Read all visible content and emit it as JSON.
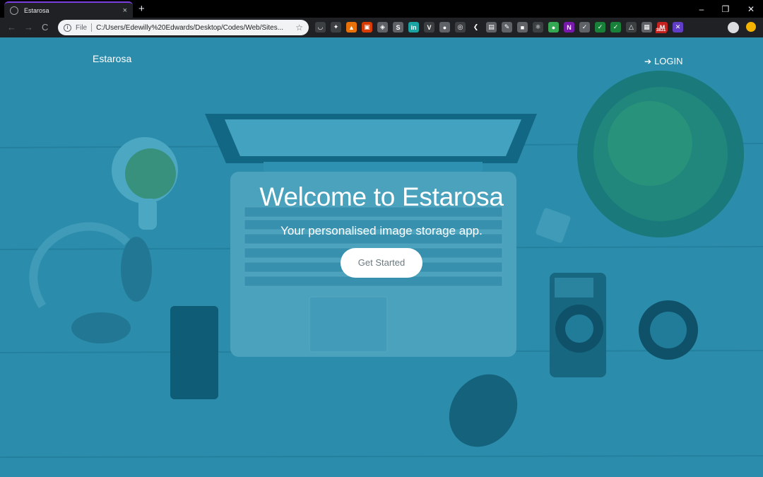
{
  "browser": {
    "tab_title": "Estarosa",
    "tab_close": "×",
    "new_tab": "+",
    "back": "←",
    "forward": "→",
    "reload": "C",
    "scheme_label": "File",
    "info_icon": "i",
    "url": "C:/Users/Edewilly%20Edwards/Desktop/Codes/Web/Sites...",
    "star": "☆",
    "window_controls": {
      "minimize": "–",
      "restore": "❐",
      "close": "✕"
    },
    "extensions": [
      {
        "name": "pocket-icon",
        "color": "#3c4043",
        "glyph": "◡"
      },
      {
        "name": "dropbox-icon",
        "color": "#3c4043",
        "glyph": "✦"
      },
      {
        "name": "ext-orange-icon",
        "color": "#e8710a",
        "glyph": "▲"
      },
      {
        "name": "office-icon",
        "color": "#d83b01",
        "glyph": "▣"
      },
      {
        "name": "ext-white-icon",
        "color": "#5f6368",
        "glyph": "◈"
      },
      {
        "name": "ext-s-icon",
        "color": "#5f6368",
        "glyph": "S"
      },
      {
        "name": "invision-icon",
        "color": "#1aa3a3",
        "glyph": "in"
      },
      {
        "name": "vue-icon",
        "color": "#3c4043",
        "glyph": "V"
      },
      {
        "name": "ext-dots-icon",
        "color": "#5f6368",
        "glyph": "●"
      },
      {
        "name": "ext-circle-icon",
        "color": "#3c4043",
        "glyph": "◎"
      },
      {
        "name": "ext-arrow-icon",
        "color": "#202124",
        "glyph": "❮"
      },
      {
        "name": "ext-doc-icon",
        "color": "#5f6368",
        "glyph": "▤"
      },
      {
        "name": "ext-edit-icon",
        "color": "#5f6368",
        "glyph": "✎"
      },
      {
        "name": "ext-box-icon",
        "color": "#5f6368",
        "glyph": "■"
      },
      {
        "name": "react-icon",
        "color": "#3c4043",
        "glyph": "⚛"
      },
      {
        "name": "ext-green-icon",
        "color": "#34a853",
        "glyph": "●"
      },
      {
        "name": "onenote-icon",
        "color": "#7719aa",
        "glyph": "N"
      },
      {
        "name": "ext-check-icon",
        "color": "#5f6368",
        "glyph": "✓"
      },
      {
        "name": "ext-check-green-icon",
        "color": "#188038",
        "glyph": "✓"
      },
      {
        "name": "ext-check-green2-icon",
        "color": "#188038",
        "glyph": "✓"
      },
      {
        "name": "drive-icon",
        "color": "#3c4043",
        "glyph": "△"
      },
      {
        "name": "ext-grid-icon",
        "color": "#5f6368",
        "glyph": "▦"
      },
      {
        "name": "gmail-icon",
        "color": "#c5221f",
        "glyph": "M"
      },
      {
        "name": "ext-purple-icon",
        "color": "#5f3dc4",
        "glyph": "✕"
      }
    ],
    "gmail_badge": "3831"
  },
  "page": {
    "brand": "Estarosa",
    "login_icon": "➔",
    "login_label": "LOGIN",
    "hero_title": "Welcome to Estarosa",
    "hero_subtitle": "Your personalised image storage app.",
    "cta_label": "Get Started"
  }
}
